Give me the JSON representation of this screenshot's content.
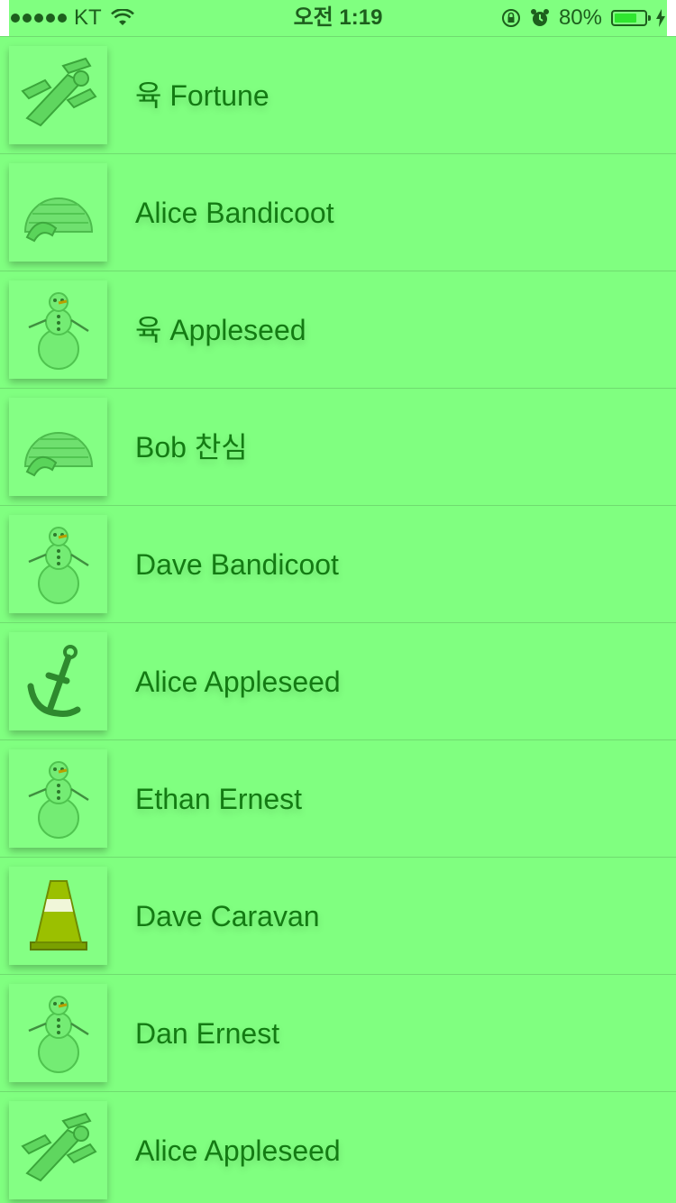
{
  "status_bar": {
    "carrier": "KT",
    "time": "오전 1:19",
    "battery_text": "80%",
    "battery_level": 0.8,
    "battery_color": "#2fe62f"
  },
  "colors": {
    "background": "#80ff80",
    "text": "#137b13"
  },
  "contacts": [
    {
      "name": "육 Fortune",
      "icon": "xwing-icon"
    },
    {
      "name": "Alice Bandicoot",
      "icon": "igloo-icon"
    },
    {
      "name": "육 Appleseed",
      "icon": "snowman-icon"
    },
    {
      "name": "Bob 찬심",
      "icon": "igloo-icon"
    },
    {
      "name": "Dave Bandicoot",
      "icon": "snowman-icon"
    },
    {
      "name": "Alice Appleseed",
      "icon": "anchor-icon"
    },
    {
      "name": "Ethan Ernest",
      "icon": "snowman-icon"
    },
    {
      "name": "Dave Caravan",
      "icon": "traffic-cone-icon"
    },
    {
      "name": "Dan Ernest",
      "icon": "snowman-icon"
    },
    {
      "name": "Alice Appleseed",
      "icon": "xwing-icon"
    }
  ]
}
